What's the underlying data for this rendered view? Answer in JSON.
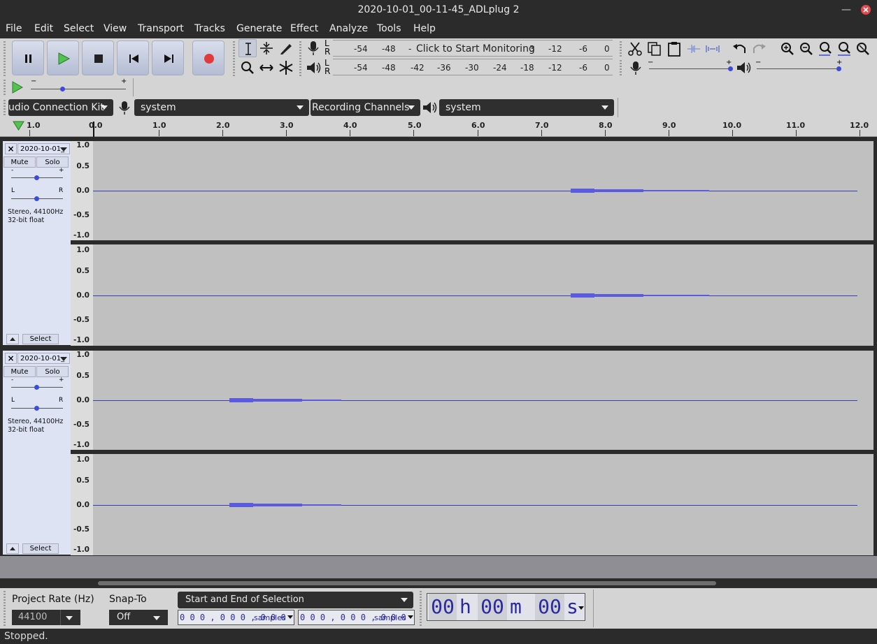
{
  "window": {
    "title": "2020-10-01_00-11-45_ADLplug 2"
  },
  "menu": [
    "File",
    "Edit",
    "Select",
    "View",
    "Transport",
    "Tracks",
    "Generate",
    "Effect",
    "Analyze",
    "Tools",
    "Help"
  ],
  "meters": {
    "record_scale": [
      "-54",
      "-48",
      "-",
      "-12",
      "-6",
      "0"
    ],
    "record_prompt": "Click to Start Monitoring",
    "record_prompt_tail": "3",
    "play_scale": [
      "-54",
      "-48",
      "-42",
      "-36",
      "-30",
      "-24",
      "-18",
      "-12",
      "-6",
      "0"
    ],
    "lr": [
      "L",
      "R"
    ]
  },
  "device_bar": {
    "host": "udio Connection Kit",
    "rec_device": "system",
    "channels": "Recording Channels",
    "play_device": "system"
  },
  "ruler": {
    "labels": [
      "1.0",
      "0.0",
      "1.0",
      "2.0",
      "3.0",
      "4.0",
      "5.0",
      "6.0",
      "7.0",
      "8.0",
      "9.0",
      "10.0",
      "11.0",
      "12.0"
    ]
  },
  "tracks": [
    {
      "name": "2020-10-01_",
      "mute": "Mute",
      "solo": "Solo",
      "gain_minus": "-",
      "gain_plus": "+",
      "pan_l": "L",
      "pan_r": "R",
      "info1": "Stereo, 44100Hz",
      "info2": "32-bit float",
      "select": "Select"
    },
    {
      "name": "2020-10-01_",
      "mute": "Mute",
      "solo": "Solo",
      "gain_minus": "-",
      "gain_plus": "+",
      "pan_l": "L",
      "pan_r": "R",
      "info1": "Stereo, 44100Hz",
      "info2": "32-bit float",
      "select": "Select"
    }
  ],
  "vruler_labels": [
    "1.0",
    "0.5",
    "0.0",
    "-0.5",
    "-1.0"
  ],
  "selection_toolbar": {
    "project_rate_label": "Project Rate (Hz)",
    "project_rate": "44100",
    "snap_label": "Snap-To",
    "snap": "Off",
    "selection_mode": "Start and End of Selection",
    "start_value": "0 0 0 , 0 0 0 , 0 0 0",
    "end_value": "0 0 0 , 0 0 0 , 0 0 0",
    "units": "samples",
    "time_display": {
      "h": "00",
      "h_unit": "h",
      "m": "00",
      "m_unit": "m",
      "s": "00",
      "s_unit": "s"
    }
  },
  "status": "Stopped."
}
